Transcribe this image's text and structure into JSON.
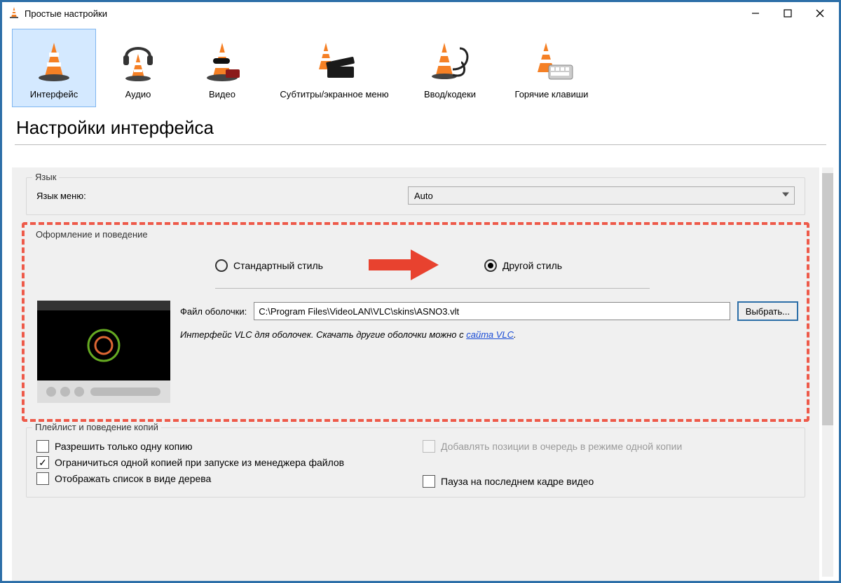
{
  "window": {
    "title": "Простые настройки"
  },
  "categories": {
    "interface": "Интерфейс",
    "audio": "Аудио",
    "video": "Видео",
    "subtitles": "Субтитры/экранное меню",
    "input": "Ввод/кодеки",
    "hotkeys": "Горячие клавиши"
  },
  "page": {
    "heading": "Настройки интерфейса"
  },
  "lang": {
    "group": "Язык",
    "label": "Язык меню:",
    "value": "Auto"
  },
  "look": {
    "group": "Оформление и поведение",
    "radio_standard": "Стандартный стиль",
    "radio_custom": "Другой стиль",
    "skinfile_label": "Файл оболочки:",
    "skinfile_value": "C:\\Program Files\\VideoLAN\\VLC\\skins\\ASNO3.vlt",
    "choose": "Выбрать...",
    "hint_prefix": "Интерфейс VLC для оболочек. Скачать другие оболочки можно с ",
    "hint_link": "сайта VLC",
    "hint_suffix": "."
  },
  "playlist": {
    "group": "Плейлист и поведение копий",
    "allow_one": "Разрешить только одну копию",
    "enqueue": "Добавлять позиции в очередь в режиме одной копии",
    "limit_one_launch": "Ограничиться одной копией при запуске из менеджера файлов",
    "tree_view": "Отображать список в виде дерева",
    "pause_last_frame": "Пауза на последнем кадре видео"
  }
}
